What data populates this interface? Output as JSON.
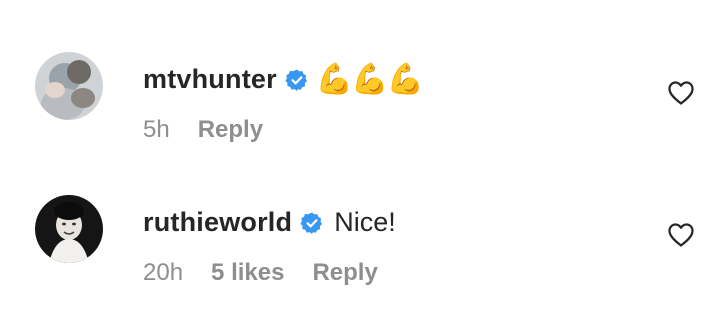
{
  "comments": [
    {
      "username": "mtvhunter",
      "verified_icon": "verified-badge-icon",
      "text": "💪💪💪",
      "time": "5h",
      "likes": "",
      "reply_label": "Reply",
      "like_icon": "heart-outline-icon"
    },
    {
      "username": "ruthieworld",
      "verified_icon": "verified-badge-icon",
      "text": "Nice!",
      "time": "20h",
      "likes": "5 likes",
      "reply_label": "Reply",
      "like_icon": "heart-outline-icon"
    }
  ],
  "colors": {
    "text": "#262626",
    "secondary": "#8e8e8e",
    "verified": "#3897f0",
    "background": "#ffffff"
  }
}
